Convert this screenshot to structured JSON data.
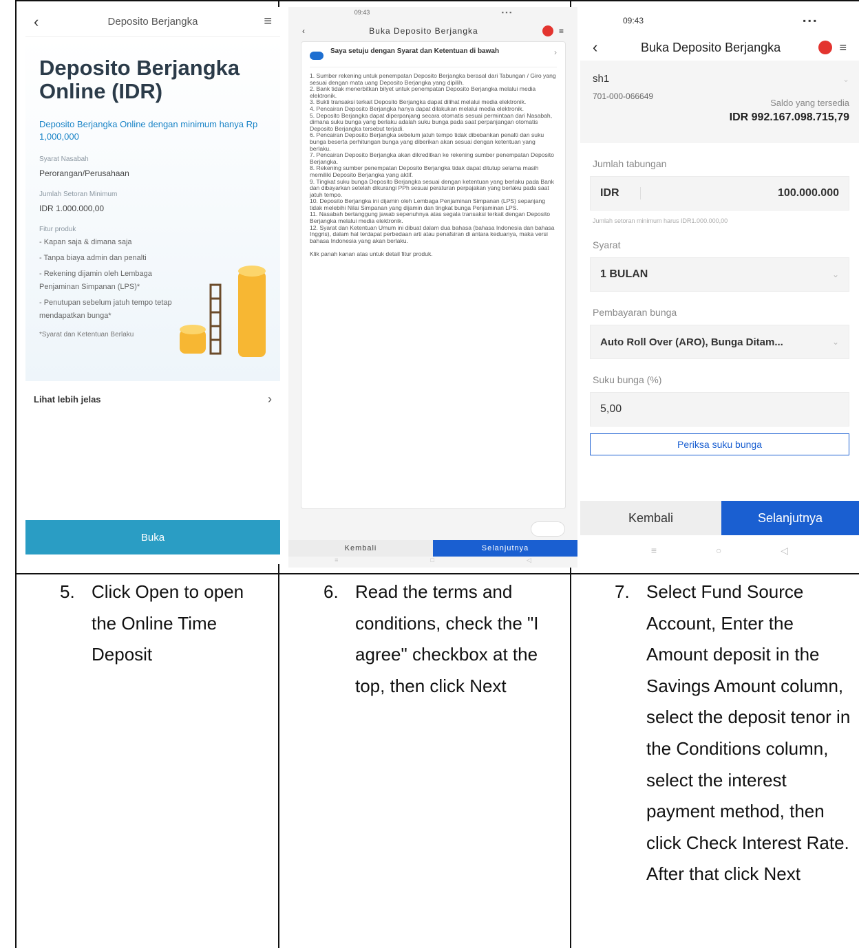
{
  "screen1": {
    "title": "Deposito Berjangka",
    "heading": "Deposito Berjangka Online (IDR)",
    "subtitle": "Deposito Berjangka Online dengan minimum hanya Rp 1,000,000",
    "customer_type_label": "Syarat Nasabah",
    "customer_type_value": "Perorangan/Perusahaan",
    "min_deposit_label": "Jumlah Setoran Minimum",
    "min_deposit_value": "IDR 1.000.000,00",
    "features_label": "Fitur produk",
    "features": [
      "- Kapan saja & dimana saja",
      "- Tanpa biaya admin dan penalti",
      "- Rekening dijamin oleh Lembaga Penjaminan Simpanan (LPS)*",
      "- Penutupan sebelum jatuh tempo tetap mendapatkan bunga*"
    ],
    "footnote": "*Syarat dan Ketentuan Berlaku",
    "more_label": "Lihat lebih jelas",
    "open_button": "Buka"
  },
  "screen2": {
    "status_time": "09:43",
    "title": "Buka Deposito Berjangka",
    "agree_text": "Saya setuju dengan Syarat dan Ketentuan di bawah",
    "terms": "1. Sumber rekening untuk penempatan Deposito Berjangka berasal dari Tabungan / Giro yang sesuai dengan mata uang Deposito Berjangka yang dipilih.\n2. Bank tidak menerbitkan bilyet untuk penempatan Deposito Berjangka melalui media elektronik.\n3. Bukti transaksi terkait Deposito Berjangka dapat dilihat melalui media elektronik.\n4. Pencairan Deposito Berjangka hanya dapat dilakukan melalui media elektronik.\n5. Deposito Berjangka dapat diperpanjang secara otomatis sesuai permintaan dari Nasabah, dimana suku bunga yang berlaku adalah suku bunga pada saat perpanjangan otomatis Deposito Berjangka tersebut terjadi.\n6. Pencairan Deposito Berjangka sebelum jatuh tempo tidak dibebankan penalti dan suku bunga beserta perhitungan bunga yang diberikan akan sesuai dengan ketentuan yang berlaku.\n7. Pencairan Deposito Berjangka akan dikreditkan ke rekening sumber penempatan Deposito Berjangka.\n8. Rekening sumber penempatan Deposito Berjangka tidak dapat ditutup selama masih memiliki Deposito Berjangka yang aktif.\n9. Tingkat suku bunga Deposito Berjangka sesuai dengan ketentuan yang berlaku pada Bank dan dibayarkan setelah dikurangi PPh sesuai peraturan perpajakan yang berlaku pada saat jatuh tempo.\n10. Deposito Berjangka ini dijamin oleh Lembaga Penjaminan Simpanan (LPS) sepanjang tidak melebihi Nilai Simpanan yang dijamin dan tingkat bunga Penjaminan LPS.\n11. Nasabah bertanggung jawab sepenuhnya atas segala transaksi terkait dengan Deposito Berjangka melalui media elektronik.\n12. Syarat dan Ketentuan Umum ini dibuat dalam dua bahasa (bahasa Indonesia dan bahasa Inggris), dalam hal terdapat perbedaan arti atau penafsiran di antara keduanya, maka versi bahasa Indonesia yang akan berlaku.\n\nKlik panah kanan atas untuk detail fitur produk.",
    "back_button": "Kembali",
    "next_button": "Selanjutnya"
  },
  "screen3": {
    "status_time": "09:43",
    "title": "Buka Deposito Berjangka",
    "account_name": "sh1",
    "account_number": "701-000-066649",
    "balance_label": "Saldo yang tersedia",
    "balance_value": "IDR 992.167.098.715,79",
    "amount_label": "Jumlah tabungan",
    "currency": "IDR",
    "amount_value": "100.000.000",
    "amount_hint": "Jumlah setoran minimum harus IDR1.000.000,00",
    "tenor_label": "Syarat",
    "tenor_value": "1 BULAN",
    "interest_payment_label": "Pembayaran bunga",
    "interest_payment_value": "Auto Roll Over (ARO), Bunga Ditam...",
    "rate_label": "Suku bunga (%)",
    "rate_value": "5,00",
    "check_rate_button": "Periksa suku bunga",
    "back_button": "Kembali",
    "next_button": "Selanjutnya"
  },
  "captions": [
    {
      "number": "5.",
      "text": "Click Open to open the Online Time Deposit"
    },
    {
      "number": "6.",
      "text": "Read the terms and conditions, check the \"I agree\" checkbox at the top, then click Next"
    },
    {
      "number": "7.",
      "text": "Select Fund Source Account, Enter the Amount deposit in the Savings Amount column, select the deposit tenor in the Conditions column, select the interest payment method, then click Check Interest Rate. After that click Next"
    }
  ],
  "colors": {
    "accent": "#1a5fd1",
    "open_button": "#2a9dc4",
    "badge": "#e3342f",
    "subtitle": "#1a84c7"
  }
}
